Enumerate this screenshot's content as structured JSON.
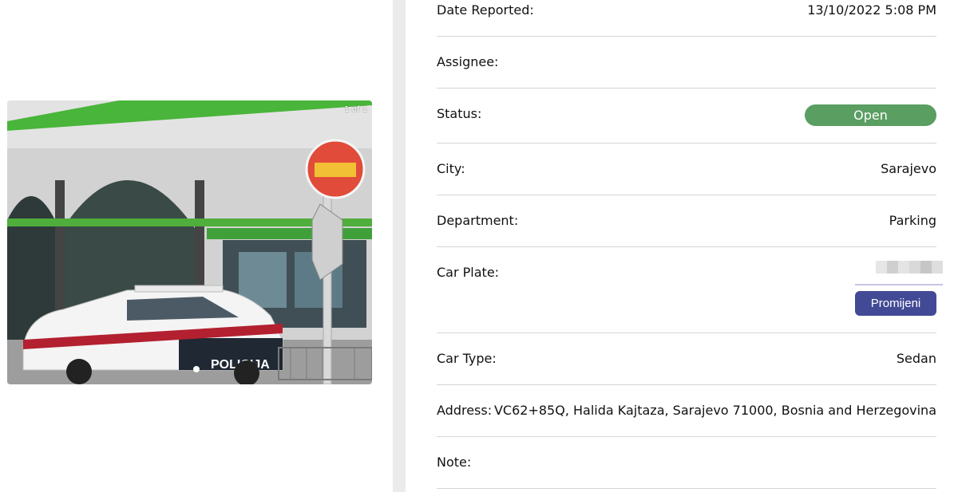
{
  "gallery": {
    "counter": "1 of 1",
    "photo_alt": "police-car-photo"
  },
  "details": {
    "date_reported": {
      "label": "Date Reported:",
      "value": "13/10/2022 5:08 PM"
    },
    "assignee": {
      "label": "Assignee:",
      "value": ""
    },
    "status": {
      "label": "Status:",
      "value": "Open",
      "color": "#5a9e62"
    },
    "city": {
      "label": "City:",
      "value": "Sarajevo"
    },
    "department": {
      "label": "Department:",
      "value": "Parking"
    },
    "car_plate": {
      "label": "Car Plate:",
      "change_label": "Promijeni",
      "button_color": "#424a96"
    },
    "car_type": {
      "label": "Car Type:",
      "value": "Sedan"
    },
    "address": {
      "label": "Address:",
      "value": "VC62+85Q, Halida Kajtaza, Sarajevo 71000, Bosnia and Herzegovina"
    },
    "note": {
      "label": "Note:",
      "value": ""
    }
  }
}
